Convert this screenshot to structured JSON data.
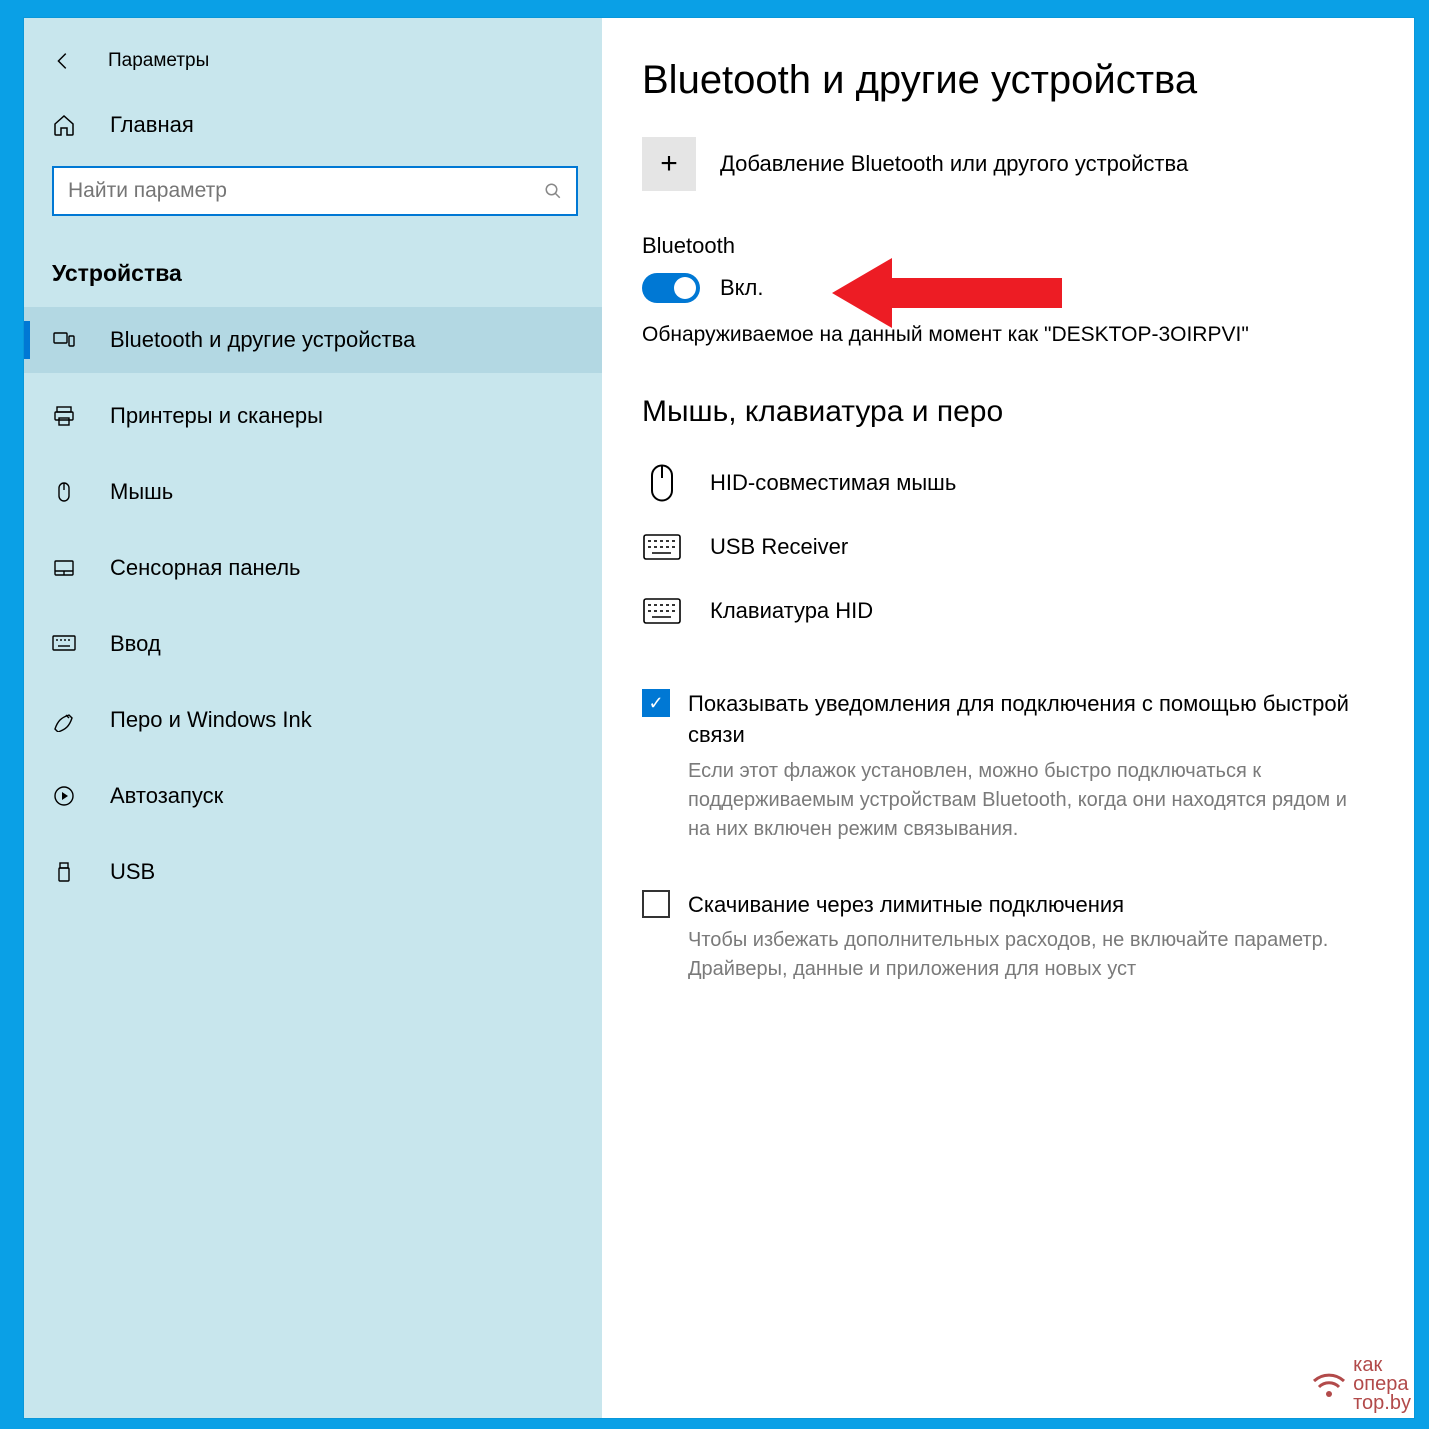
{
  "window": {
    "title": "Параметры"
  },
  "sidebar": {
    "home": "Главная",
    "search_placeholder": "Найти параметр",
    "category": "Устройства",
    "items": [
      {
        "label": "Bluetooth и другие устройства"
      },
      {
        "label": "Принтеры и сканеры"
      },
      {
        "label": "Мышь"
      },
      {
        "label": "Сенсорная панель"
      },
      {
        "label": "Ввод"
      },
      {
        "label": "Перо и Windows Ink"
      },
      {
        "label": "Автозапуск"
      },
      {
        "label": "USB"
      }
    ]
  },
  "main": {
    "heading": "Bluetooth и другие устройства",
    "add_label": "Добавление Bluetooth или другого устройства",
    "bt_label": "Bluetooth",
    "bt_state": "Вкл.",
    "discoverable": "Обнаруживаемое на данный момент как \"DESKTOP-3OIRPVI\"",
    "section_mouse": "Мышь, клавиатура и перо",
    "devices": [
      {
        "label": "HID-совместимая мышь"
      },
      {
        "label": "USB Receiver"
      },
      {
        "label": "Клавиатура HID"
      }
    ],
    "check1_label": "Показывать уведомления для подключения с помощью быстрой связи",
    "check1_desc": "Если этот флажок установлен, можно быстро подключаться к поддерживаемым устройствам Bluetooth, когда они находятся рядом и на них включен режим связывания.",
    "check2_label": "Скачивание через лимитные подключения",
    "check2_desc": "Чтобы избежать дополнительных расходов, не включайте параметр. Драйверы, данные и приложения для новых уст"
  },
  "watermark": {
    "line1": "как",
    "line2": "опера",
    "line3": "тор.by"
  }
}
